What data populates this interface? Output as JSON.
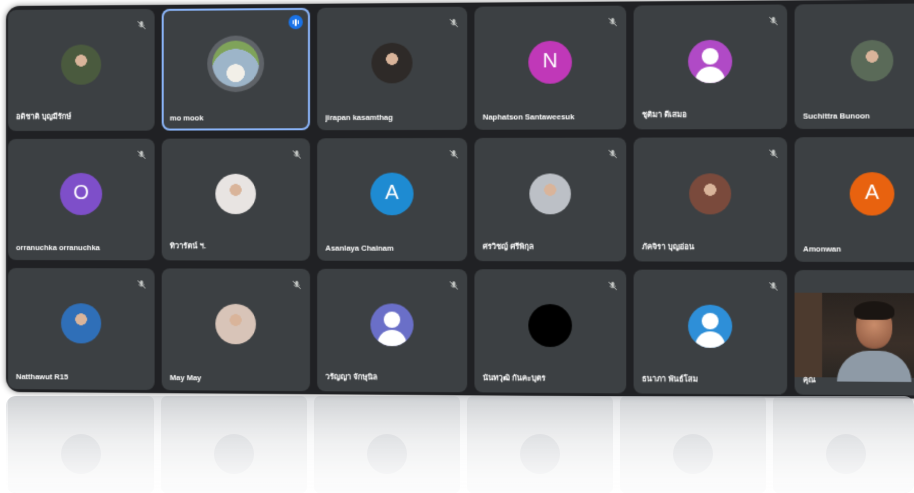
{
  "participants": [
    {
      "name": "อดิชาติ บุญมีรักษ์",
      "avatar": "photo",
      "avatar_icon": "photo-avatar",
      "color": "#4a5a3e",
      "mic": "muted",
      "speaking": false
    },
    {
      "name": "mo mook",
      "avatar": "photo-ring",
      "avatar_icon": "photo-avatar",
      "color": "#9db5c9",
      "mic": "active",
      "speaking": true
    },
    {
      "name": "jirapan kasamthag",
      "avatar": "photo",
      "avatar_icon": "photo-avatar",
      "color": "#2e2a28",
      "mic": "muted",
      "speaking": false
    },
    {
      "name": "Naphatson Santaweesuk",
      "avatar": "letter",
      "letter": "N",
      "color": "#c038b8",
      "mic": "muted",
      "speaking": false
    },
    {
      "name": "ชุติมา ดีเสมอ",
      "avatar": "person",
      "avatar_icon": "person-icon",
      "color": "#b04ac6",
      "mic": "muted",
      "speaking": false
    },
    {
      "name": "Suchittra Bunoon",
      "avatar": "photo",
      "avatar_icon": "photo-avatar",
      "color": "#5a6a58",
      "mic": "muted",
      "speaking": false
    },
    {
      "name": "orranuchka orranuchka",
      "avatar": "letter",
      "letter": "O",
      "color": "#7e4fc9",
      "mic": "muted",
      "speaking": false
    },
    {
      "name": "ทิวารัตน์ ฯ.",
      "avatar": "photo",
      "avatar_icon": "photo-avatar",
      "color": "#e8e4e2",
      "mic": "muted",
      "speaking": false
    },
    {
      "name": "Asanlaya Chainam",
      "avatar": "letter",
      "letter": "A",
      "color": "#1e8bd2",
      "mic": "muted",
      "speaking": false
    },
    {
      "name": "ศรวิชญ์ ศรีพิกุล",
      "avatar": "photo",
      "avatar_icon": "photo-avatar",
      "color": "#bcc0c6",
      "mic": "muted",
      "speaking": false
    },
    {
      "name": "ภัคจิรา บุญอ่อน",
      "avatar": "photo",
      "avatar_icon": "photo-avatar",
      "color": "#7a4a3c",
      "mic": "muted",
      "speaking": false
    },
    {
      "name": "Amonwan",
      "avatar": "letter",
      "letter": "A",
      "color": "#e8620f",
      "mic": "muted",
      "speaking": false
    },
    {
      "name": "Natthawut R15",
      "avatar": "photo",
      "avatar_icon": "photo-avatar",
      "color": "#2f6fb8",
      "mic": "muted",
      "speaking": false
    },
    {
      "name": "May May",
      "avatar": "photo",
      "avatar_icon": "photo-avatar",
      "color": "#d8c4b8",
      "mic": "muted",
      "speaking": false
    },
    {
      "name": "วรัญญา จักษุนิล",
      "avatar": "person",
      "avatar_icon": "person-icon",
      "color": "#6a6fc8",
      "mic": "muted",
      "speaking": false
    },
    {
      "name": "นันทวุฒิ กันคะบุตร",
      "avatar": "blank",
      "avatar_icon": "dark-avatar",
      "color": "#000000",
      "mic": "muted",
      "speaking": false
    },
    {
      "name": "ธนาภา พันธ์โสม",
      "avatar": "person",
      "avatar_icon": "person-icon",
      "color": "#2e8fd8",
      "mic": "muted",
      "speaking": false
    },
    {
      "name": "คุณ",
      "avatar": "video",
      "avatar_icon": "camera-video",
      "color": "#2a2420",
      "mic": "active",
      "speaking": true
    }
  ],
  "icons": {
    "muted_mic": "mic-off-icon",
    "speaking": "audio-level-icon"
  },
  "colors": {
    "background": "#202124",
    "tile": "#3c4043",
    "speaking_border": "#8ab4f8",
    "speaking_badge": "#1a73e8"
  }
}
